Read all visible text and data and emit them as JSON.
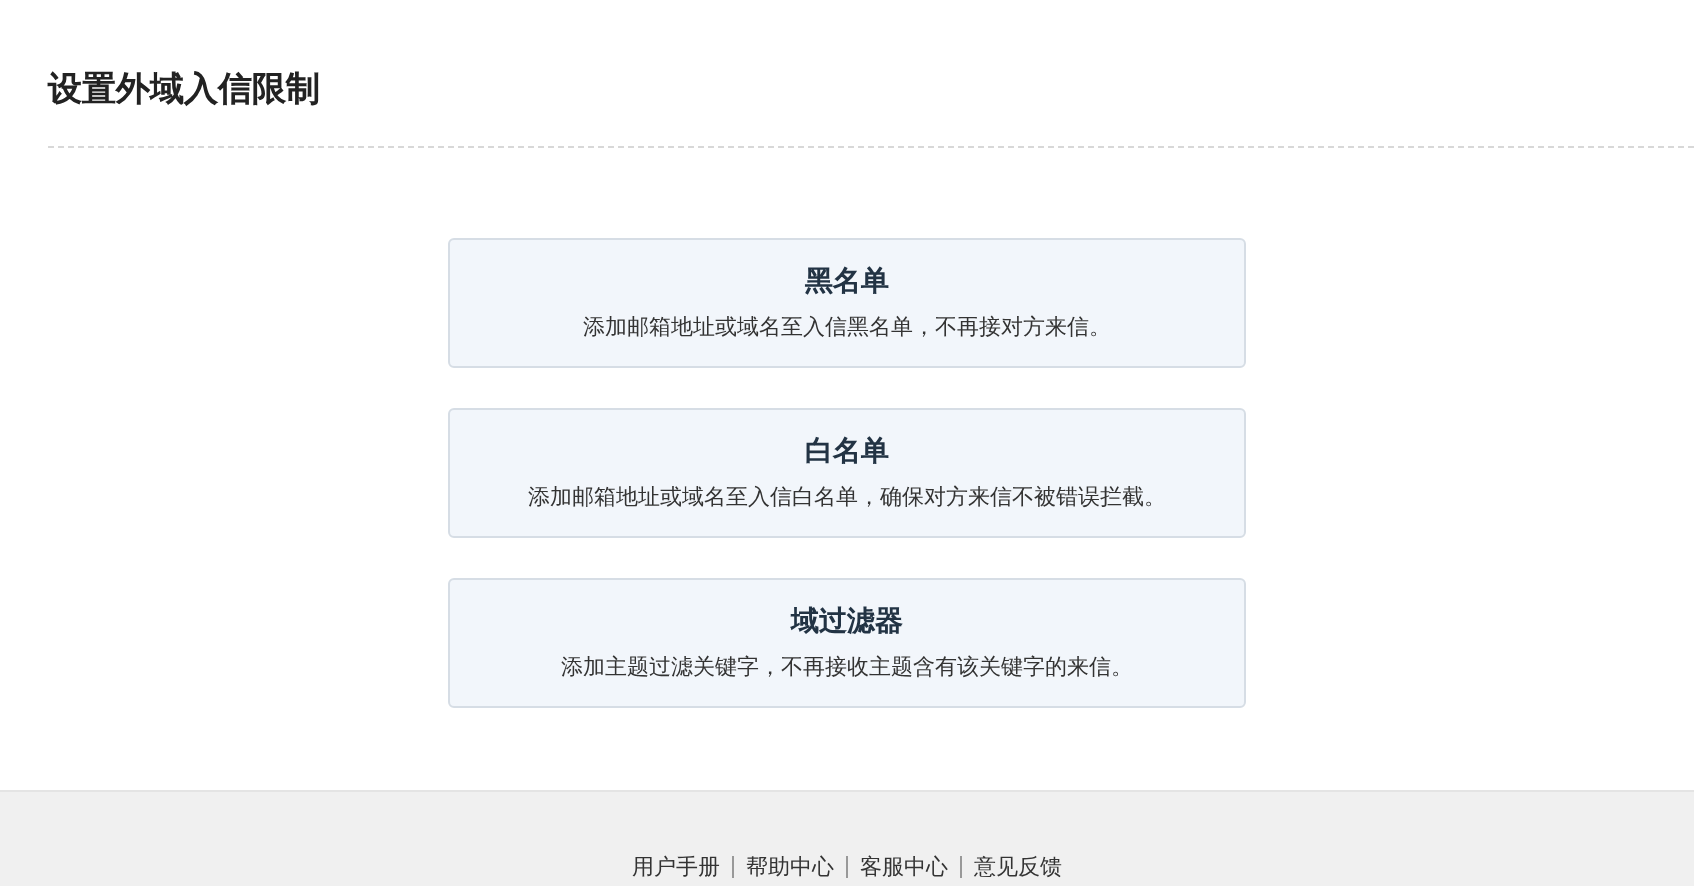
{
  "page": {
    "title": "设置外域入信限制"
  },
  "options": [
    {
      "title": "黑名单",
      "description": "添加邮箱地址或域名至入信黑名单，不再接对方来信。"
    },
    {
      "title": "白名单",
      "description": "添加邮箱地址或域名至入信白名单，确保对方来信不被错误拦截。"
    },
    {
      "title": "域过滤器",
      "description": "添加主题过滤关键字，不再接收主题含有该关键字的来信。"
    }
  ],
  "footer": {
    "links": [
      "用户手册",
      "帮助中心",
      "客服中心",
      "意见反馈"
    ]
  }
}
